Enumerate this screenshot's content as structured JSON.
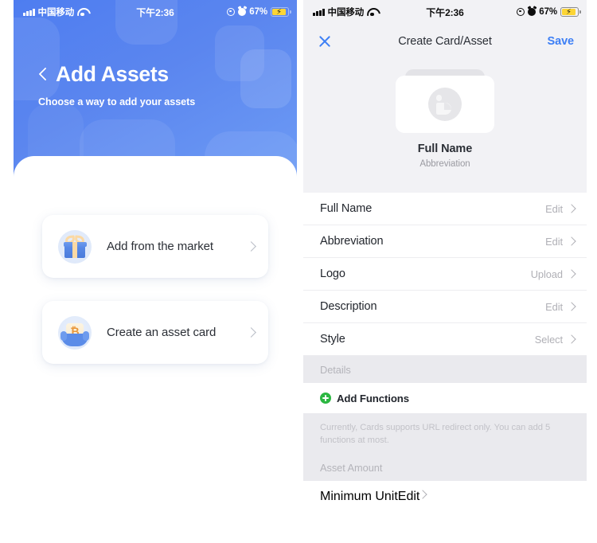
{
  "status_bar": {
    "carrier": "中国移动",
    "time": "下午2:36",
    "battery_percent": "67%",
    "signal_icon": "signal-bars-icon",
    "wifi_icon": "wifi-icon",
    "location_icon": "location-services-icon",
    "alarm_icon": "alarm-clock-icon",
    "battery_icon": "battery-charging-icon"
  },
  "colors": {
    "accent_blue": "#3d7ff5",
    "hero_blue": "#5b86ef",
    "green": "#2cb742",
    "battery_yellow": "#fcd535",
    "group_gray": "#eaeaee",
    "muted_text": "#b0b0b6"
  },
  "left_screen": {
    "back_icon": "chevron-left-icon",
    "title": "Add Assets",
    "subtitle": "Choose a way to add your assets",
    "options": [
      {
        "id": "market",
        "icon": "gift-box-icon",
        "label": "Add from the market",
        "chevron": "chevron-right-icon"
      },
      {
        "id": "create",
        "icon": "bitcoin-coin-icon",
        "label": "Create an asset card",
        "chevron": "chevron-right-icon"
      }
    ]
  },
  "right_screen": {
    "nav": {
      "close_icon": "close-x-icon",
      "title": "Create Card/Asset",
      "save_label": "Save"
    },
    "preview": {
      "logo_placeholder_icon": "default-logo-icon",
      "name": "Full Name",
      "abbreviation": "Abbreviation"
    },
    "form_rows": [
      {
        "label": "Full Name",
        "action": "Edit",
        "chevron": "chevron-right-icon"
      },
      {
        "label": "Abbreviation",
        "action": "Edit",
        "chevron": "chevron-right-icon"
      },
      {
        "label": "Logo",
        "action": "Upload",
        "chevron": "chevron-right-icon"
      },
      {
        "label": "Description",
        "action": "Edit",
        "chevron": "chevron-right-icon"
      },
      {
        "label": "Style",
        "action": "Select",
        "chevron": "chevron-right-icon"
      }
    ],
    "details_section": {
      "header": "Details",
      "add_functions_label": "Add Functions",
      "add_functions_icon": "plus-circle-icon",
      "hint": "Currently, Cards supports URL redirect only. You can add 5 functions at most."
    },
    "asset_amount_section": {
      "header": "Asset Amount",
      "row": {
        "label": "Minimum Unit",
        "action": "Edit",
        "chevron": "chevron-right-icon"
      }
    }
  }
}
